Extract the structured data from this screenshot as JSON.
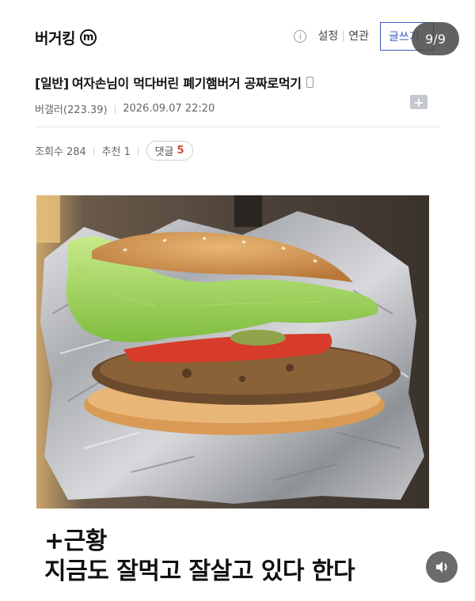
{
  "header": {
    "brand": "버거킹",
    "brand_badge": "m",
    "info_icon": "info-icon",
    "links": [
      "설정",
      "연관"
    ],
    "write_button": "글쓰기",
    "page_indicator": "9/9"
  },
  "post": {
    "category": "[일반]",
    "title": "여자손님이 먹다버린 폐기햄버거 공짜로먹기",
    "author": "버갤러(223.39)",
    "datetime": "2026.09.07 22:20",
    "views_label": "조회수 284",
    "likes_label": "추천 1",
    "comments_label": "댓글",
    "comments_count": "5"
  },
  "caption": {
    "line1": "+근황",
    "line2": "지금도 잘먹고 잘살고 있다 한다"
  },
  "colors": {
    "accent_blue": "#3b5bbf",
    "comment_count": "#d0473a"
  },
  "icons": {
    "mobile": "mobile-icon",
    "add": "add-icon",
    "speaker": "speaker-icon"
  }
}
